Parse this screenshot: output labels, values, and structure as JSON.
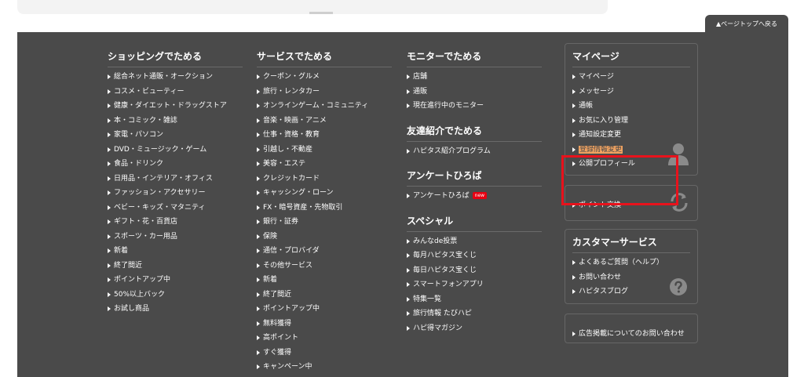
{
  "page_top": {
    "label": "▲ページトップへ戻る"
  },
  "shopping": {
    "title": "ショッピングでためる",
    "items": [
      "総合ネット通販・オークション",
      "コスメ・ビューティー",
      "健康・ダイエット・ドラッグストア",
      "本・コミック・雑誌",
      "家電・パソコン",
      "DVD・ミュージック・ゲーム",
      "食品・ドリンク",
      "日用品・インテリア・オフィス",
      "ファッション・アクセサリー",
      "ベビー・キッズ・マタニティ",
      "ギフト・花・百貨店",
      "スポーツ・カー用品",
      "新着",
      "終了間近",
      "ポイントアップ中",
      "50%以上バック",
      "お試し商品"
    ]
  },
  "services": {
    "title": "サービスでためる",
    "items": [
      "クーポン・グルメ",
      "旅行・レンタカー",
      "オンラインゲーム・コミュニティ",
      "音楽・映画・アニメ",
      "仕事・資格・教育",
      "引越し・不動産",
      "美容・エステ",
      "クレジットカード",
      "キャッシング・ローン",
      "FX・暗号資産・先物取引",
      "銀行・証券",
      "保険",
      "通信・プロバイダ",
      "その他サービス",
      "新着",
      "終了間近",
      "ポイントアップ中",
      "無料獲得",
      "高ポイント",
      "すぐ獲得",
      "キャンペーン中"
    ]
  },
  "monitor": {
    "title": "モニターでためる",
    "items": [
      "店舗",
      "通販",
      "現在進行中のモニター"
    ]
  },
  "friend": {
    "title": "友達紹介でためる",
    "items": [
      "ハピタス紹介プログラム"
    ]
  },
  "survey": {
    "title": "アンケートひろば",
    "item": "アンケートひろば",
    "badge": "new"
  },
  "special": {
    "title": "スペシャル",
    "items": [
      "みんなde投票",
      "毎月ハピタス宝くじ",
      "毎日ハピタス宝くじ",
      "スマートフォンアプリ",
      "特集一覧",
      "旅行情報 たびハピ",
      "ハピ得マガジン"
    ]
  },
  "mypage": {
    "title": "マイページ",
    "items": [
      "マイページ",
      "メッセージ",
      "通帳",
      "お気に入り管理",
      "通知設定変更"
    ],
    "highlighted_item": "登録情報変更",
    "profile_item": "公開プロフィール",
    "icon": "user-silhouette-icon"
  },
  "point_exchange": {
    "label": "ポイント交換",
    "icon": "refresh-icon"
  },
  "customer": {
    "title": "カスタマーサービス",
    "items": [
      "よくあるご質問（ヘルプ）",
      "お問い合わせ",
      "ハピタスブログ"
    ],
    "icon": "help-icon"
  },
  "advertising": {
    "label": "広告掲載についてのお問い合わせ"
  },
  "colors": {
    "footer_bg": "#4a4a4a",
    "highlight": "#f0a260",
    "annotation_frame": "#e8121c",
    "new_badge": "#e60012"
  }
}
